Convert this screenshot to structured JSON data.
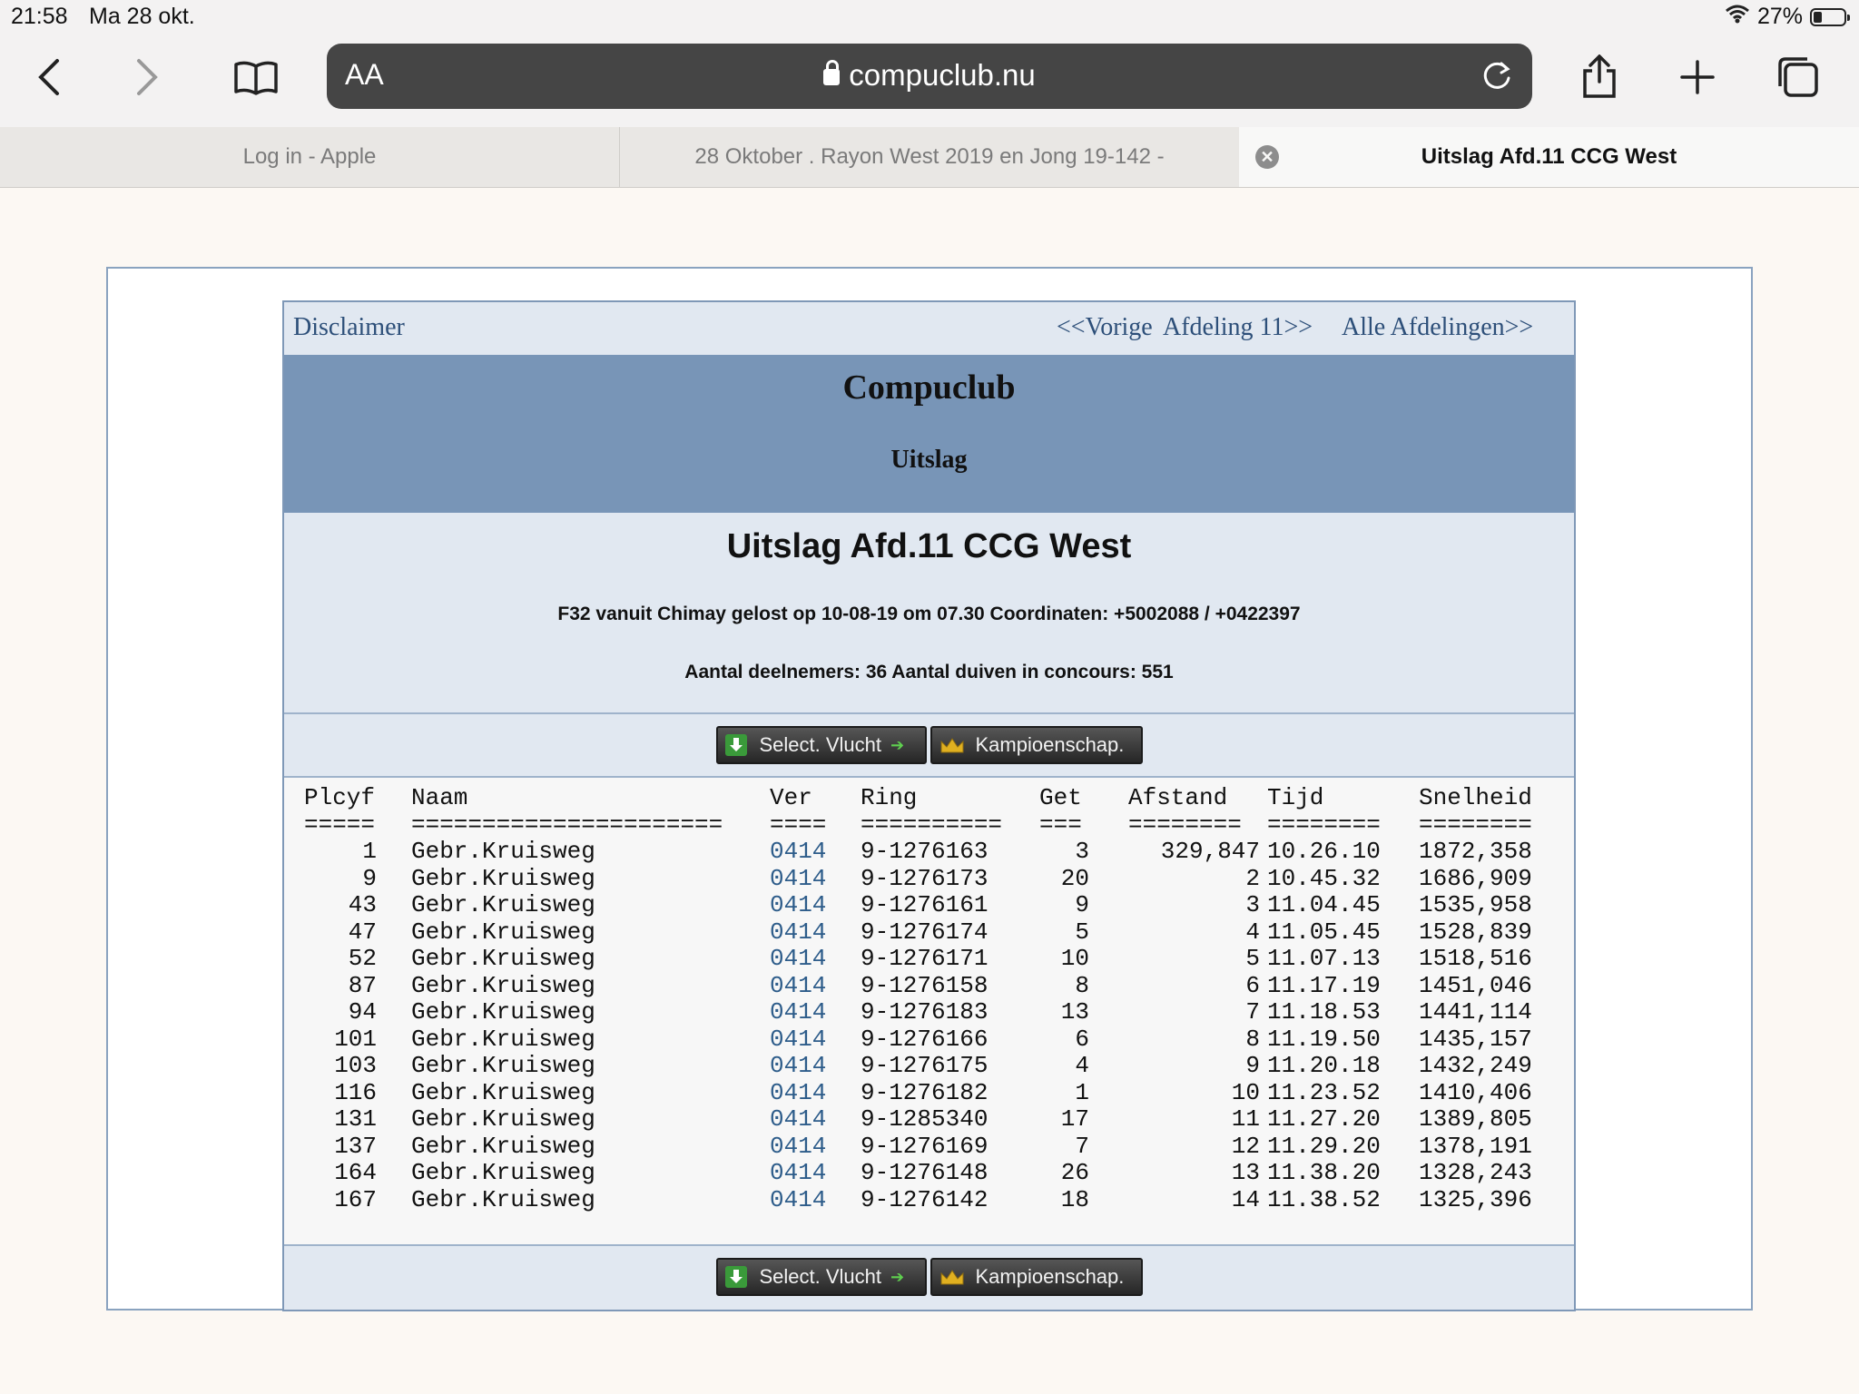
{
  "status": {
    "time": "21:58",
    "date": "Ma 28 okt.",
    "battery": "27%",
    "battery_level": 0.27
  },
  "toolbar": {
    "text_size": "AA",
    "url": "compuclub.nu"
  },
  "tabs": [
    {
      "label": "Log in - Apple"
    },
    {
      "label": "28 Oktober . Rayon West 2019 en Jong 19-142 -"
    },
    {
      "label": "Uitslag Afd.11 CCG West"
    }
  ],
  "nav": {
    "disclaimer": "Disclaimer",
    "prev": "<<Vorige",
    "afdeling": "Afdeling 11>>",
    "alle": "Alle Afdelingen>>"
  },
  "banner": {
    "title": "Compuclub",
    "subtitle": "Uitslag"
  },
  "info": {
    "heading": "Uitslag Afd.11 CCG West",
    "flight": "F32 vanuit Chimay gelost op 10-08-19 om 07.30 Coordinaten: +5002088 / +0422397",
    "participants": "Aantal deelnemers: 36 Aantal duiven in concours: 551"
  },
  "buttons": {
    "select": "Select. Vlucht",
    "kampioen": "Kampioenschap."
  },
  "table": {
    "headers": [
      "Plcyf",
      "Naam",
      "Ver",
      "Ring",
      "Get",
      "Afstand",
      "Tijd",
      "Snelheid"
    ],
    "separators": [
      "=====",
      "======================",
      "====",
      "==========",
      "===",
      "========",
      "========",
      "========"
    ],
    "rows": [
      [
        "1",
        "Gebr.Kruisweg",
        "0414",
        "9-1276163",
        "3",
        "329,847",
        "10.26.10",
        "1872,358"
      ],
      [
        "9",
        "Gebr.Kruisweg",
        "0414",
        "9-1276173",
        "20",
        "2",
        "10.45.32",
        "1686,909"
      ],
      [
        "43",
        "Gebr.Kruisweg",
        "0414",
        "9-1276161",
        "9",
        "3",
        "11.04.45",
        "1535,958"
      ],
      [
        "47",
        "Gebr.Kruisweg",
        "0414",
        "9-1276174",
        "5",
        "4",
        "11.05.45",
        "1528,839"
      ],
      [
        "52",
        "Gebr.Kruisweg",
        "0414",
        "9-1276171",
        "10",
        "5",
        "11.07.13",
        "1518,516"
      ],
      [
        "87",
        "Gebr.Kruisweg",
        "0414",
        "9-1276158",
        "8",
        "6",
        "11.17.19",
        "1451,046"
      ],
      [
        "94",
        "Gebr.Kruisweg",
        "0414",
        "9-1276183",
        "13",
        "7",
        "11.18.53",
        "1441,114"
      ],
      [
        "101",
        "Gebr.Kruisweg",
        "0414",
        "9-1276166",
        "6",
        "8",
        "11.19.50",
        "1435,157"
      ],
      [
        "103",
        "Gebr.Kruisweg",
        "0414",
        "9-1276175",
        "4",
        "9",
        "11.20.18",
        "1432,249"
      ],
      [
        "116",
        "Gebr.Kruisweg",
        "0414",
        "9-1276182",
        "1",
        "10",
        "11.23.52",
        "1410,406"
      ],
      [
        "131",
        "Gebr.Kruisweg",
        "0414",
        "9-1285340",
        "17",
        "11",
        "11.27.20",
        "1389,805"
      ],
      [
        "137",
        "Gebr.Kruisweg",
        "0414",
        "9-1276169",
        "7",
        "12",
        "11.29.20",
        "1378,191"
      ],
      [
        "164",
        "Gebr.Kruisweg",
        "0414",
        "9-1276148",
        "26",
        "13",
        "11.38.20",
        "1328,243"
      ],
      [
        "167",
        "Gebr.Kruisweg",
        "0414",
        "9-1276142",
        "18",
        "14",
        "11.38.52",
        "1325,396"
      ]
    ]
  }
}
